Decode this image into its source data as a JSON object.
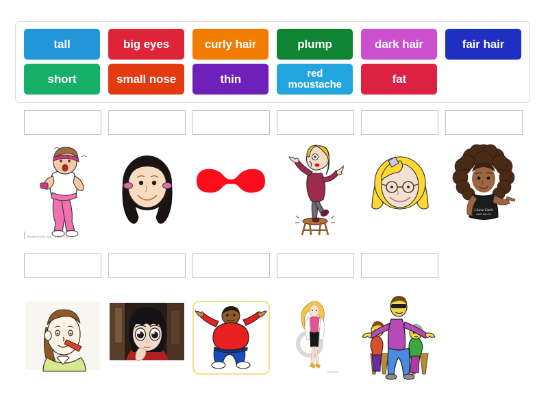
{
  "activity": {
    "type": "drag-and-drop matching",
    "word_bank": {
      "rows": [
        [
          {
            "label": "tall",
            "color": "#2196d8"
          },
          {
            "label": "big eyes",
            "color": "#dd2438"
          },
          {
            "label": "curly hair",
            "color": "#f07d00"
          },
          {
            "label": "plump",
            "color": "#0f8432"
          },
          {
            "label": "dark hair",
            "color": "#cc4fd0"
          },
          {
            "label": "fair hair",
            "color": "#1f2fc2"
          }
        ],
        [
          {
            "label": "short",
            "color": "#16b06a"
          },
          {
            "label": "small nose",
            "color": "#e33a10"
          },
          {
            "label": "thin",
            "color": "#6f20ba"
          },
          {
            "label": "red moustache",
            "color": "#22a5de"
          },
          {
            "label": "fat",
            "color": "#dd2142"
          },
          {
            "label": "",
            "color": "transparent"
          }
        ]
      ]
    },
    "answer_row_1": {
      "count": 6,
      "values": [
        "",
        "",
        "",
        "",
        "",
        ""
      ]
    },
    "answer_row_2": {
      "count": 5,
      "values": [
        "",
        "",
        "",
        "",
        ""
      ]
    },
    "pictures_row_1": [
      {
        "name": "plump-woman-exercising",
        "alt": "plump woman jogging with dumbbell",
        "watermark": "shutterstock.com · 36267288"
      },
      {
        "name": "girl-dark-hair",
        "alt": "smiling girl with long dark hair in pigtails"
      },
      {
        "name": "red-moustache",
        "alt": "large red handlebar moustache"
      },
      {
        "name": "thin-woman-on-stool",
        "alt": "thin cartoon woman standing on a stool"
      },
      {
        "name": "girl-fair-hair-glasses",
        "alt": "blonde girl face with round glasses and bow"
      },
      {
        "name": "woman-curly-afro",
        "alt": "woman with big curly afro hair and black t-shirt"
      }
    ],
    "pictures_row_2": [
      {
        "name": "girl-small-nose",
        "alt": "cartoon girl pointing at her small nose"
      },
      {
        "name": "anime-girl-big-eyes",
        "alt": "anime girl portrait with very big eyes"
      },
      {
        "name": "fat-man-red-shirt",
        "alt": "fat man in red shirt with arms outstretched",
        "framed": true
      },
      {
        "name": "tall-slim-woman",
        "alt": "tall slim fashion woman illustration",
        "signature": "illustration"
      },
      {
        "name": "tall-man-with-children",
        "alt": "tall man with sunglasses beside two short people on stools"
      }
    ],
    "colors": {
      "panel_border": "#dcdcdc",
      "dropzone_border": "#bfbfbf",
      "background": "#ffffff",
      "frame_highlight": "#f2e08a"
    }
  }
}
